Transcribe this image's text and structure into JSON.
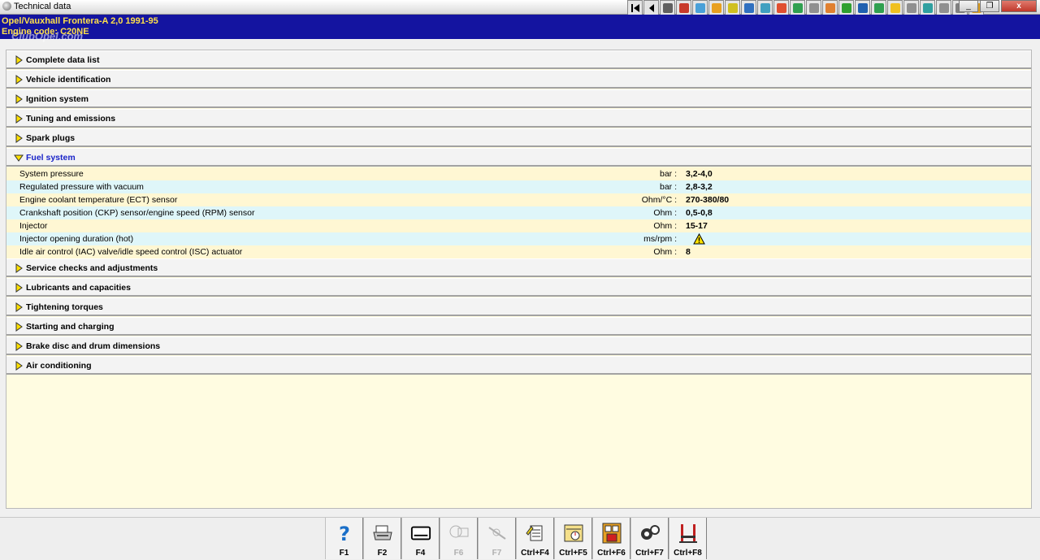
{
  "window": {
    "title": "Technical data",
    "close_glyph": "x",
    "min_glyph": "_",
    "restore_glyph": "❐"
  },
  "vehicle": {
    "line1": "Opel/Vauxhall   Frontera-A  2,0  1991-95",
    "line2": "Engine code: C20NE",
    "watermark": "ClubOpel.com"
  },
  "toolbar": {
    "icons": [
      "first-icon",
      "prev-icon",
      "warning-icon",
      "chart-icon",
      "diagram-icon",
      "gear-icon",
      "battery-icon",
      "wheel-icon",
      "tool-icon",
      "lift-icon",
      "engine-icon",
      "oil-icon",
      "spanner-icon",
      "relay-icon",
      "fuse-icon",
      "car-icon",
      "tyre-icon",
      "wiper-icon",
      "steering-icon",
      "triangle-icon",
      "brake-icon",
      "info-icon"
    ],
    "colors": [
      "#000000",
      "#000000",
      "#606060",
      "#c83a2a",
      "#4aa0d8",
      "#e8a020",
      "#d0c020",
      "#3070c0",
      "#40a0c0",
      "#e05030",
      "#30a050",
      "#909090",
      "#e08030",
      "#30a030",
      "#2060b0",
      "#30a050",
      "#f0c020",
      "#909090",
      "#30a0a0",
      "#909090",
      "#808080",
      "#e0a020"
    ]
  },
  "sections_top": [
    {
      "label": "Complete data list"
    },
    {
      "label": "Vehicle identification"
    },
    {
      "label": "Ignition system"
    },
    {
      "label": "Tuning and emissions"
    },
    {
      "label": "Spark plugs"
    }
  ],
  "fuel_system": {
    "label": "Fuel system",
    "rows": [
      {
        "name": "System pressure",
        "unit": "bar :",
        "value": "3,2-4,0"
      },
      {
        "name": "Regulated pressure with vacuum",
        "unit": "bar :",
        "value": "2,8-3,2"
      },
      {
        "name": "Engine coolant temperature (ECT) sensor",
        "unit": "Ohm/°C :",
        "value": "270-380/80"
      },
      {
        "name": "Crankshaft position (CKP) sensor/engine speed (RPM) sensor",
        "unit": "Ohm :",
        "value": "0,5-0,8"
      },
      {
        "name": "Injector",
        "unit": "Ohm :",
        "value": "15-17"
      },
      {
        "name": "Injector opening duration (hot)",
        "unit": "ms/rpm :",
        "value": ""
      },
      {
        "name": "Idle air control (IAC) valve/idle speed control (ISC) actuator",
        "unit": "Ohm :",
        "value": "8"
      }
    ]
  },
  "sections_bottom": [
    {
      "label": "Service checks and adjustments"
    },
    {
      "label": "Lubricants and capacities"
    },
    {
      "label": "Tightening torques"
    },
    {
      "label": "Starting and charging"
    },
    {
      "label": "Brake disc and drum dimensions"
    },
    {
      "label": "Air conditioning"
    }
  ],
  "function_keys": [
    {
      "key": "F1",
      "icon": "help-icon",
      "enabled": true
    },
    {
      "key": "F2",
      "icon": "print-icon",
      "enabled": true
    },
    {
      "key": "F4",
      "icon": "screen-icon",
      "enabled": true
    },
    {
      "key": "F6",
      "icon": "dbinfo-icon",
      "enabled": false
    },
    {
      "key": "F7",
      "icon": "satellite-icon",
      "enabled": false
    },
    {
      "key": "Ctrl+F4",
      "icon": "notes-icon",
      "enabled": true
    },
    {
      "key": "Ctrl+F5",
      "icon": "timer-icon",
      "enabled": true
    },
    {
      "key": "Ctrl+F6",
      "icon": "calculator-icon",
      "enabled": true
    },
    {
      "key": "Ctrl+F7",
      "icon": "gears-icon",
      "enabled": true
    },
    {
      "key": "Ctrl+F8",
      "icon": "jack-icon",
      "enabled": true
    }
  ]
}
